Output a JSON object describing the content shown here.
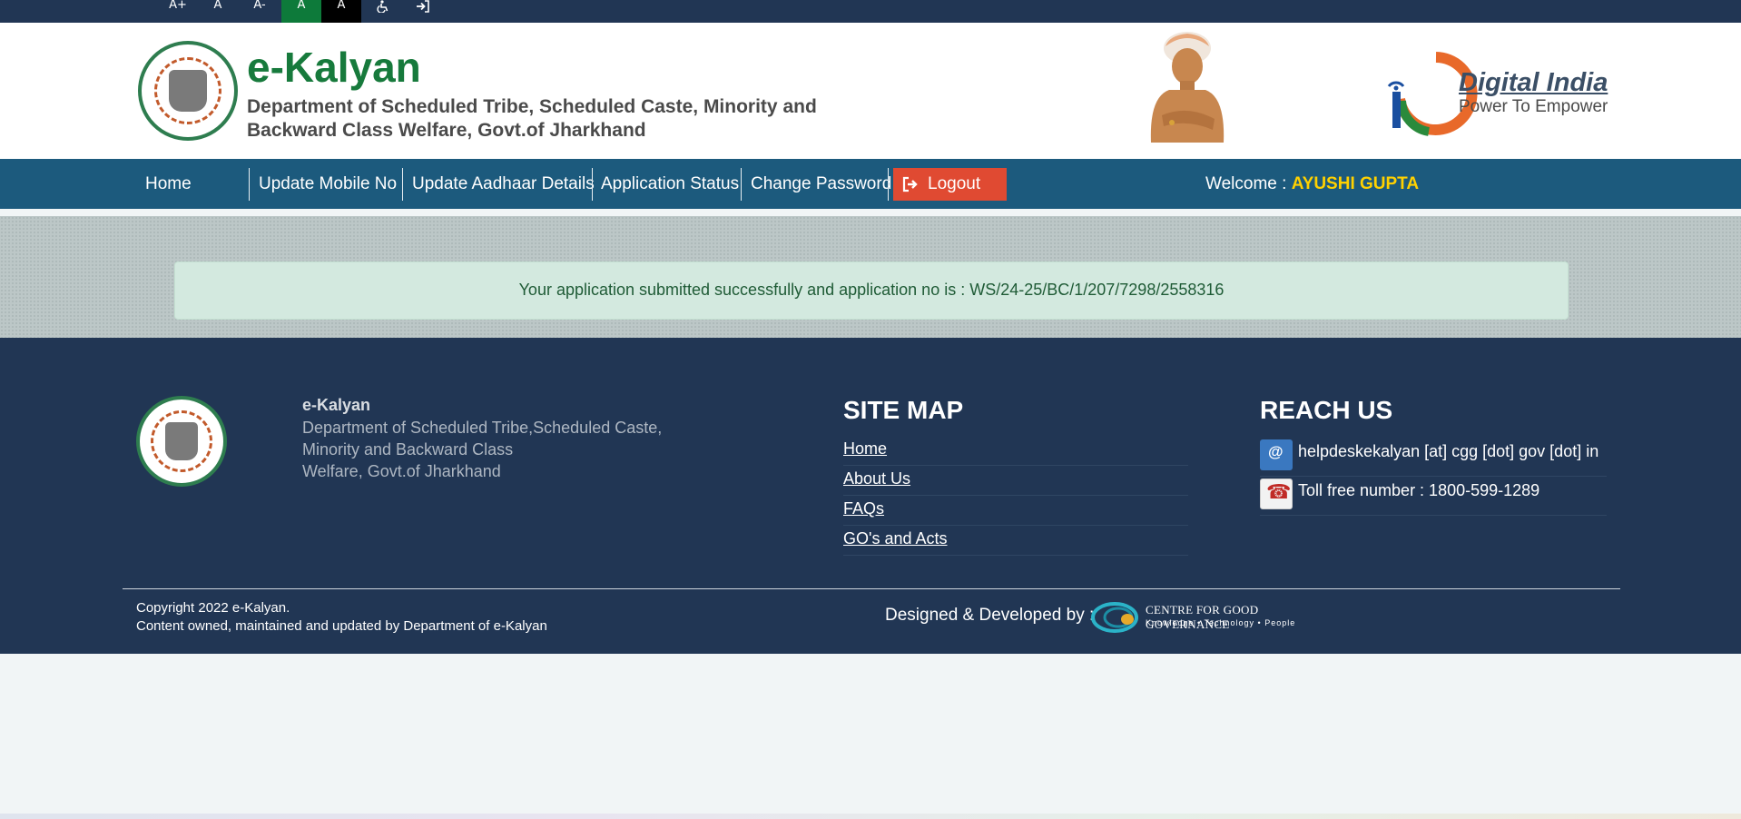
{
  "accessibility_bar": {
    "font_increase": "A+",
    "font_normal": "A",
    "font_decrease": "A-",
    "theme_green": "A",
    "theme_dark": "A",
    "accessibility_icon": "wheelchair-icon",
    "login_icon": "sign-in-icon"
  },
  "header": {
    "title": "e-Kalyan",
    "subtitle": "Department of Scheduled Tribe, Scheduled Caste, Minority and Backward Class Welfare, Govt.of Jharkhand",
    "digital_india_title": "Digital India",
    "digital_india_tagline": "Power To Empower"
  },
  "nav": {
    "items": [
      {
        "label": "Home"
      },
      {
        "label": "Update Mobile No"
      },
      {
        "label": "Update Aadhaar Details"
      },
      {
        "label": "Application Status"
      },
      {
        "label": "Change Password"
      }
    ],
    "logout_label": "Logout",
    "welcome_prefix": "Welcome :",
    "user_name": "AYUSHI GUPTA"
  },
  "alert": {
    "message": "Your application submitted successfully and application no is : WS/24-25/BC/1/207/7298/2558316"
  },
  "footer": {
    "org_name": "e-Kalyan",
    "org_desc_lines": [
      "Department of Scheduled Tribe,Scheduled Caste,",
      "Minority and Backward Class",
      "Welfare, Govt.of Jharkhand"
    ],
    "sitemap_heading": "SITE MAP",
    "sitemap_links": [
      {
        "label": "Home"
      },
      {
        "label": "About Us"
      },
      {
        "label": "FAQs"
      },
      {
        "label": "GO's and Acts"
      }
    ],
    "reach_heading": "REACH US",
    "email": "helpdeskekalyan [at] cgg [dot] gov [dot] in",
    "tollfree": "Toll free number : 1800-599-1289",
    "copyright": "Copyright 2022 e-Kalyan.",
    "content_owned": "Content owned, maintained and updated by Department of e-Kalyan",
    "designed_by": "Designed & Developed by :",
    "cgg_name": "CENTRE FOR GOOD GOVERNANCE",
    "cgg_tagline": "Knowledge • Technology • People"
  },
  "colors": {
    "topbar": "#213654",
    "nav": "#1c5a7d",
    "logout": "#e04a32",
    "brand_green": "#177a3c",
    "welcome_name": "#ffd100",
    "alert_bg": "#d3e9df",
    "footer": "#213654"
  }
}
